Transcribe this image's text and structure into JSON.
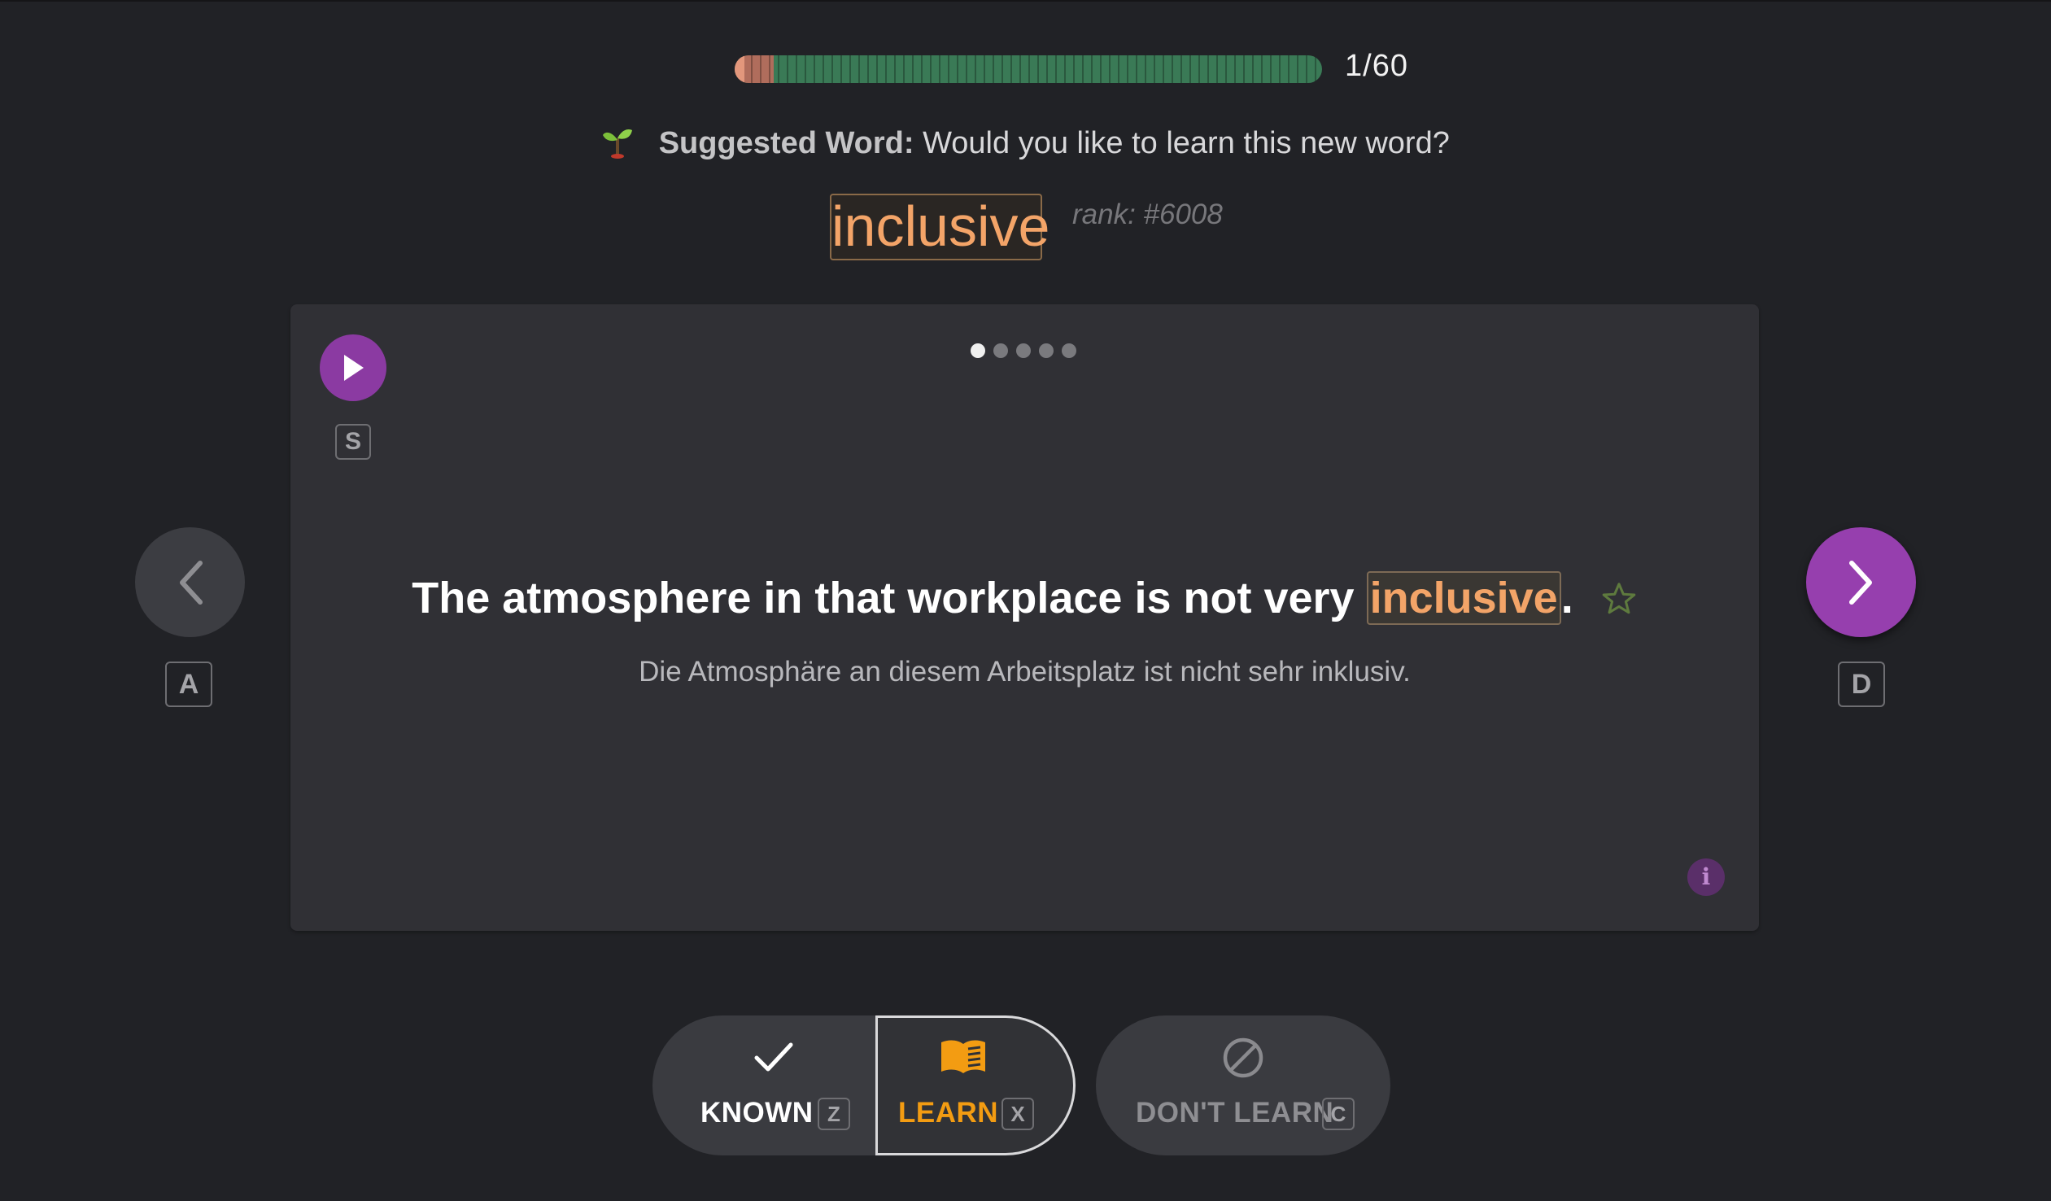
{
  "progress": {
    "current_label": "1/60",
    "fraction": 0.066
  },
  "suggestion": {
    "lead": "Suggested Word:",
    "question": "Would you like to learn this new word?",
    "icon": "sprout-icon"
  },
  "word": {
    "text": "inclusive",
    "rank": "rank: #6008"
  },
  "card": {
    "play_key": "S",
    "dots": {
      "count": 5,
      "active": 0
    },
    "sentence_before": "The atmosphere in that workplace is not very ",
    "sentence_highlight": "inclusive",
    "sentence_after": ".",
    "translation": "Die Atmosphäre an diesem Arbeitsplatz ist nicht sehr inklusiv."
  },
  "nav": {
    "prev_key": "A",
    "next_key": "D"
  },
  "actions": {
    "known": {
      "label": "KNOWN",
      "key": "Z"
    },
    "learn": {
      "label": "LEARN",
      "key": "X"
    },
    "dont_learn": {
      "label": "DON'T LEARN",
      "key": "C"
    }
  },
  "colors": {
    "background": "#212226",
    "card": "#303035",
    "accent_purple": "#963fae",
    "highlight_orange": "#f3a468",
    "progress_green": "#3a7a56",
    "learn_orange": "#f39c12"
  }
}
